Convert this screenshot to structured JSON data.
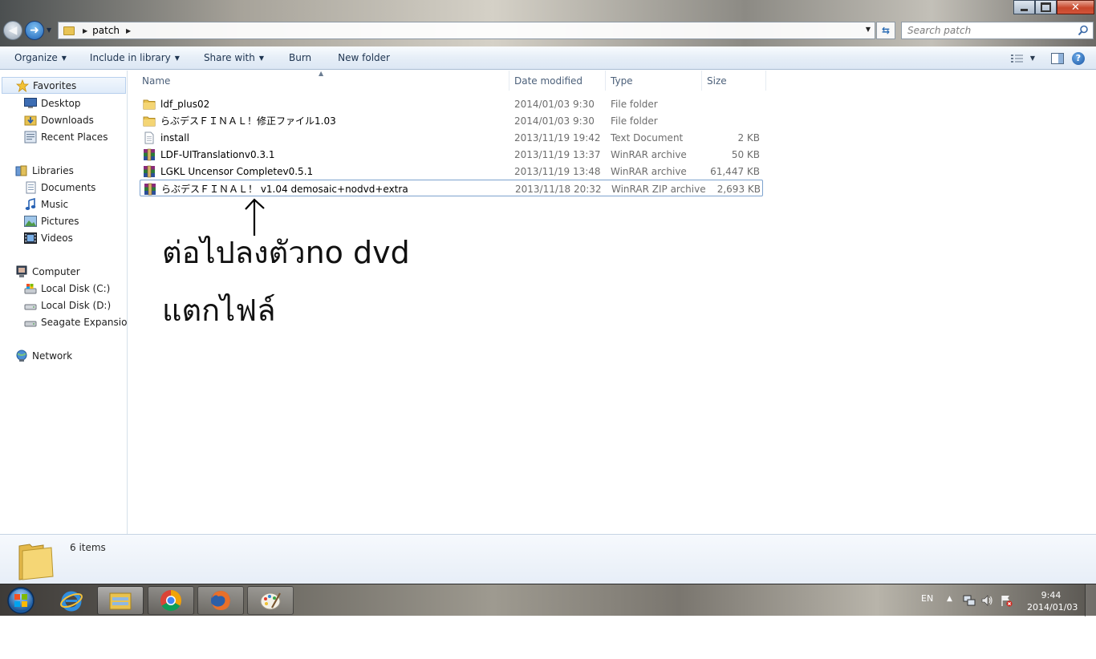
{
  "window": {
    "breadcrumb": [
      "patch"
    ],
    "search_placeholder": "Search patch"
  },
  "toolbar": {
    "organize": "Organize",
    "include_in_library": "Include in library",
    "share_with": "Share with",
    "burn": "Burn",
    "new_folder": "New folder"
  },
  "nav": {
    "favorites": "Favorites",
    "desktop": "Desktop",
    "downloads": "Downloads",
    "recent_places": "Recent Places",
    "libraries": "Libraries",
    "documents": "Documents",
    "music": "Music",
    "pictures": "Pictures",
    "videos": "Videos",
    "computer": "Computer",
    "local_c": "Local Disk (C:)",
    "local_d": "Local Disk (D:)",
    "seagate": "Seagate Expansion D",
    "network": "Network"
  },
  "columns": {
    "name": "Name",
    "date_modified": "Date modified",
    "type": "Type",
    "size": "Size"
  },
  "files": [
    {
      "name": "ldf_plus02",
      "date": "2014/01/03 9:30",
      "type": "File folder",
      "size": "",
      "icon": "folder-icon"
    },
    {
      "name": "らぶデスＦＩＮＡＬ！修正ファイル1.03",
      "date": "2014/01/03 9:30",
      "type": "File folder",
      "size": "",
      "icon": "folder-icon"
    },
    {
      "name": "install",
      "date": "2013/11/19 19:42",
      "type": "Text Document",
      "size": "2 KB",
      "icon": "text-document-icon"
    },
    {
      "name": "LDF-UITranslationv0.3.1",
      "date": "2013/11/19 13:37",
      "type": "WinRAR archive",
      "size": "50 KB",
      "icon": "winrar-icon"
    },
    {
      "name": "LGKL Uncensor Completev0.5.1",
      "date": "2013/11/19 13:48",
      "type": "WinRAR archive",
      "size": "61,447 KB",
      "icon": "winrar-icon"
    },
    {
      "name": "らぶデスＦＩＮＡＬ！ v1.04 demosaic+nodvd+extra",
      "date": "2013/11/18 20:32",
      "type": "WinRAR ZIP archive",
      "size": "2,693 KB",
      "icon": "winrar-icon"
    }
  ],
  "annotation": {
    "line1": "ต่อไปลงตัวno dvd",
    "line2": "แตกไฟล์"
  },
  "details": {
    "count": "6 items"
  },
  "taskbar": {
    "language": "EN",
    "time": "9:44",
    "date": "2014/01/03"
  }
}
